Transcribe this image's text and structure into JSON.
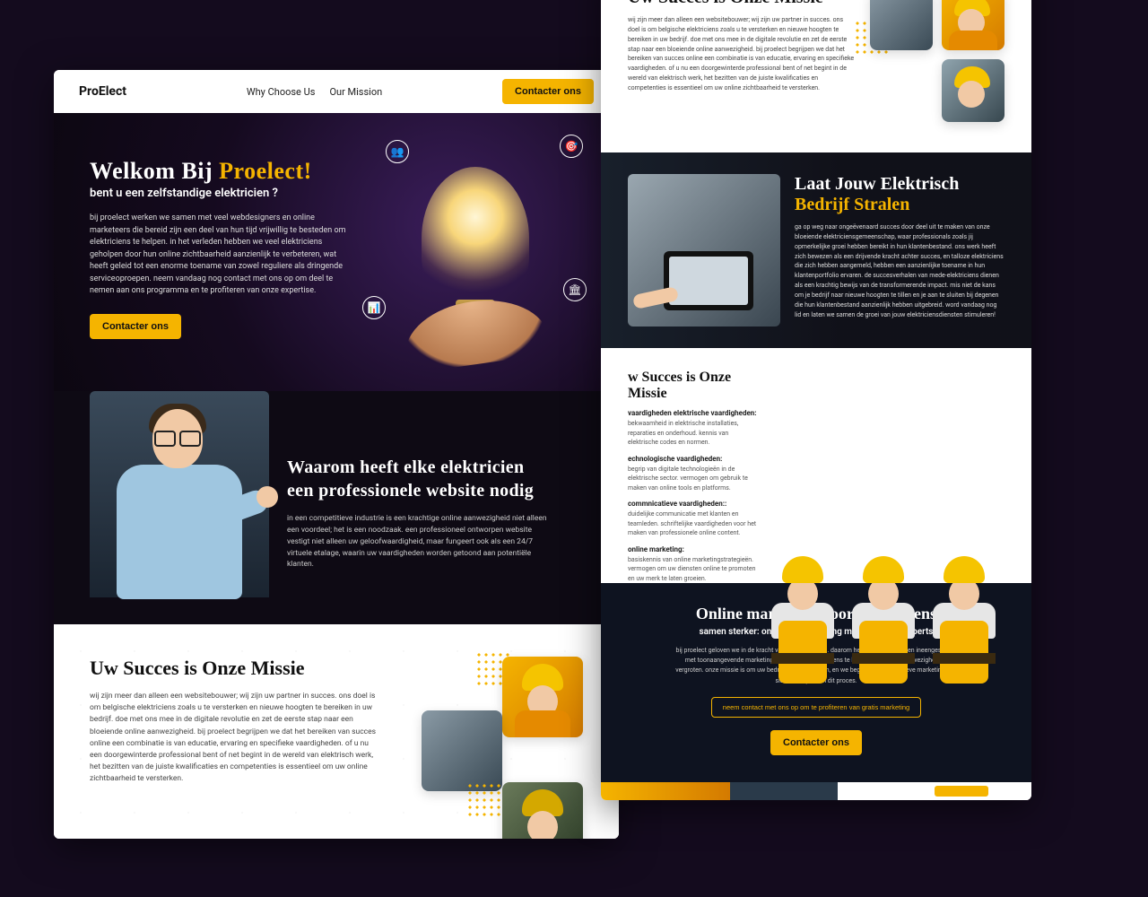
{
  "colors": {
    "accent": "#f5b400",
    "bg": "#140b1e"
  },
  "header": {
    "brand": "ProElect",
    "nav": [
      "Why Choose Us",
      "Our Mission"
    ],
    "cta": "Contacter ons"
  },
  "hero": {
    "title_pre": "Welkom Bij ",
    "title_accent": "Proelect!",
    "subtitle": "bent u een zelfstandige elektricien ?",
    "body": "bij proelect werken we samen met veel webdesigners en online marketeers die bereid zijn een deel van hun tijd vrijwillig te besteden om elektriciens te helpen. in het verleden hebben we veel elektriciens geholpen door hun online zichtbaarheid aanzienlijk te verbeteren, wat heeft geleid tot een enorme toename van zowel reguliere als dringende serviceoproepen. neem vandaag nog contact met ons op om deel te nemen aan ons programma en te profiteren van onze expertise.",
    "cta": "Contacter ons"
  },
  "why": {
    "title": "Waarom heeft elke elektricien een professionele website nodig",
    "body": "in een competitieve industrie is een krachtige online aanwezigheid niet alleen een voordeel; het is een noodzaak. een professioneel ontworpen website vestigt niet alleen uw geloofwaardigheid, maar fungeert ook als een 24/7 virtuele etalage, waarin uw vaardigheden worden getoond aan potentiële klanten."
  },
  "mission": {
    "title": "Uw Succes is Onze Missie",
    "body": "wij zijn meer dan alleen een websitebouwer; wij zijn uw partner in succes. ons doel is om belgische elektriciens zoals u te versterken en nieuwe hoogten te bereiken in uw bedrijf. doe met ons mee in de digitale revolutie en zet de eerste stap naar een bloeiende online aanwezigheid. bij proelect begrijpen we dat het bereiken van succes online een combinatie is van educatie, ervaring en specifieke vaardigheden. of u nu een doorgewinterde professional bent of net begint in de wereld van elektrisch werk, het bezitten van de juiste kwalificaties en competenties is essentieel om uw online zichtbaarheid te versterken."
  },
  "shine": {
    "title_pre": "Laat Jouw Elektrisch ",
    "title_accent": "Bedrijf Stralen",
    "body": "ga op weg naar ongeëvenaard succes door deel uit te maken van onze bloeiende elektriciensgemeenschap, waar professionals zoals jij opmerkelijke groei hebben bereikt in hun klantenbestand. ons werk heeft zich bewezen als een drijvende kracht achter succes, en talloze elektriciens die zich hebben aangemeld, hebben een aanzienlijke toename in hun klantenportfolio ervaren. de succesverhalen van mede-elektriciens dienen als een krachtig bewijs van de transformerende impact. mis niet de kans om je bedrijf naar nieuwe hoogten te tillen en je aan te sluiten bij degenen die hun klantenbestand aanzienlijk hebben uitgebreid. word vandaag nog lid en laten we samen de groei van jouw elektriciensdiensten stimuleren!"
  },
  "skills": {
    "title": "w Succes is Onze Missie",
    "items": [
      {
        "h": "vaardigheden elektrische vaardigheden:",
        "b": "bekwaamheid in elektrische installaties, reparaties en onderhoud. kennis van elektrische codes en normen."
      },
      {
        "h": "echnologische vaardigheden:",
        "b": "begrip van digitale technologieën in de elektrische sector. vermogen om gebruik te maken van online tools en platforms."
      },
      {
        "h": "commnicatieve vaardigheden::",
        "b": "duidelijke communicatie met klanten en teamleden. schriftelijke vaardigheden voor het maken van professionele online content."
      },
      {
        "h": "online marketing:",
        "b": "basiskennis van online marketingstrategieën. vermogen om uw diensten online te promoten en uw merk te laten groeien."
      }
    ]
  },
  "cta": {
    "title": "Online marketing voor elektriciens",
    "subtitle": "samen sterker: onze samenwerking met marketingexperts",
    "body": "bij proelect geloven we in de kracht van samenwerking. daarom hebben we de handen ineengeslagen met toonaangevende marketingbedrijven om elektriciens te helpen hun online aanwezigheid te vergroten. onze missie is om uw bedrijf te laten groeien, en we begrijpen dat effectieve marketing een sleutelrol speelt in dit proces.",
    "outline_btn": "neem contact met ons op om te profiteren van gratis marketing",
    "accent_btn": "Contacter ons"
  }
}
